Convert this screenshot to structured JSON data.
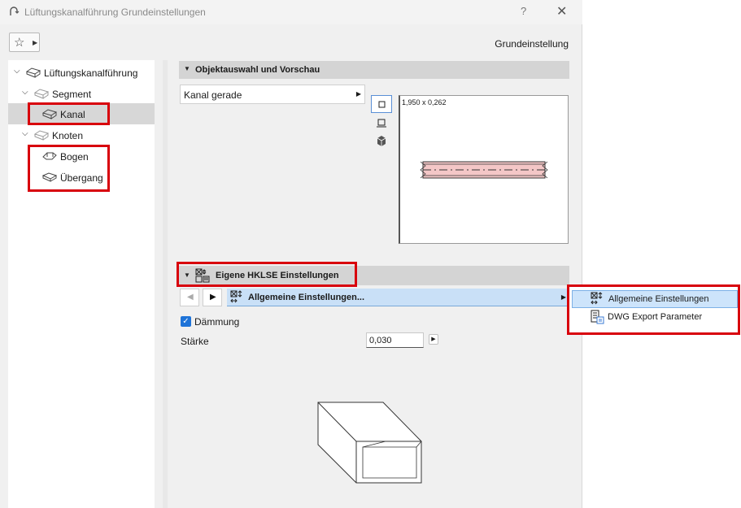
{
  "window": {
    "title": "Lüftungskanalführung Grundeinstellungen",
    "help_label": "?",
    "close_label": "✕",
    "preset_label": "Grundeinstellung"
  },
  "tree": {
    "root": "Lüftungskanalführung",
    "segment": "Segment",
    "kanal": "Kanal",
    "knoten": "Knoten",
    "bogen": "Bogen",
    "uebergang": "Übergang"
  },
  "preview_section": {
    "title": "Objektauswahl und Vorschau",
    "dropdown_value": "Kanal gerade",
    "dimensions": "1,950 x 0,262"
  },
  "mep_section": {
    "title": "Eigene HKLSE Einstellungen",
    "page_selector": "Allgemeine Einstellungen...",
    "checkbox_label": "Dämmung",
    "checkbox_checked": true,
    "field_label": "Stärke",
    "field_value": "0,030"
  },
  "popup": {
    "items": [
      "Allgemeine Einstellungen",
      "DWG Export Parameter"
    ],
    "selected_index": 0
  },
  "colors": {
    "highlight_red": "#d8000c",
    "selection_blue": "#c9e0f7",
    "checkbox_blue": "#1e73d8",
    "duct_fill": "#f4c7c7"
  },
  "icons": {
    "title": "ductwork-icon",
    "favorites": "star-icon",
    "tree": "duct-segment-icon",
    "views": [
      "plan-view-icon",
      "section-view-icon",
      "3d-view-icon"
    ],
    "mep_settings": "settings-grid-icon",
    "dwg_export": "dwg-export-icon"
  }
}
